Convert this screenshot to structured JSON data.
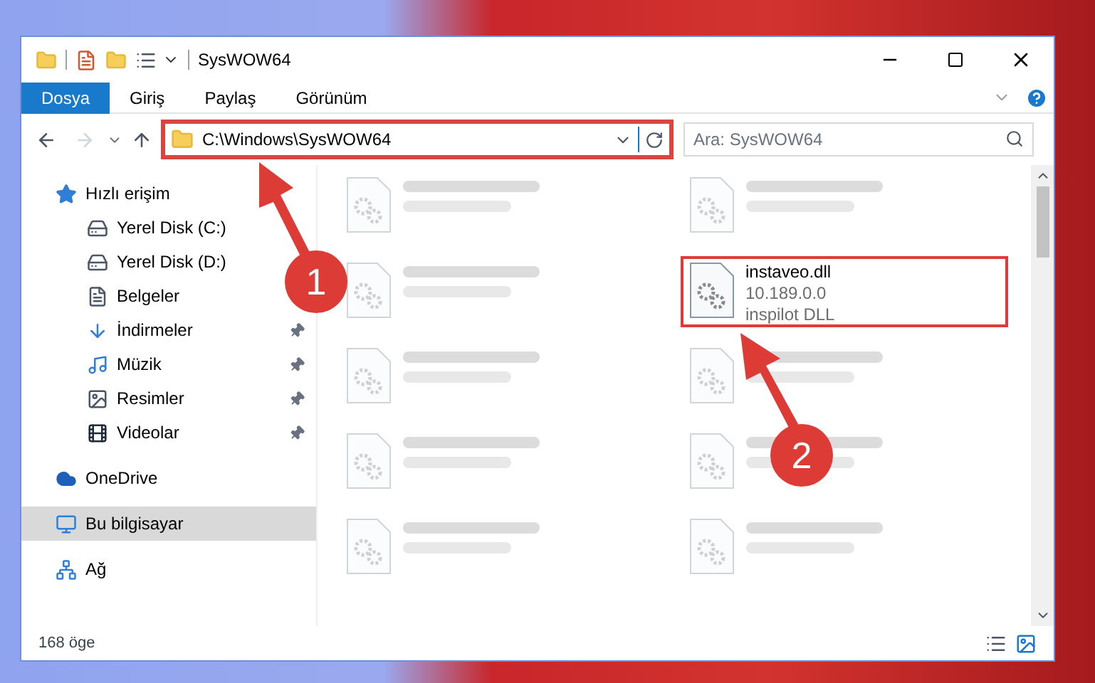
{
  "window": {
    "title": "SysWOW64"
  },
  "ribbon_tabs": [
    {
      "label": "Dosya",
      "selected": true
    },
    {
      "label": "Giriş",
      "selected": false
    },
    {
      "label": "Paylaş",
      "selected": false
    },
    {
      "label": "Görünüm",
      "selected": false
    }
  ],
  "address": {
    "path": "C:\\Windows\\SysWOW64",
    "highlighted": true
  },
  "search": {
    "placeholder": "Ara: SysWOW64"
  },
  "sidebar": {
    "items": [
      {
        "label": "Hızlı erişim",
        "kind": "star",
        "selected": false,
        "children": [
          {
            "label": "Yerel Disk (C:)",
            "kind": "drive",
            "pinned": false
          },
          {
            "label": "Yerel Disk (D:)",
            "kind": "drive",
            "pinned": false
          },
          {
            "label": "Belgeler",
            "kind": "document",
            "pinned": false
          },
          {
            "label": "İndirmeler",
            "kind": "download",
            "pinned": true
          },
          {
            "label": "Müzik",
            "kind": "music",
            "pinned": true
          },
          {
            "label": "Resimler",
            "kind": "pictures",
            "pinned": true
          },
          {
            "label": "Videolar",
            "kind": "video",
            "pinned": true
          }
        ]
      },
      {
        "label": "OneDrive",
        "kind": "cloud",
        "selected": false
      },
      {
        "label": "Bu bilgisayar",
        "kind": "computer",
        "selected": true
      },
      {
        "label": "Ağ",
        "kind": "network",
        "selected": false
      }
    ]
  },
  "files": [
    {
      "kind": "blurred"
    },
    {
      "kind": "blurred"
    },
    {
      "kind": "blurred"
    },
    {
      "kind": "file",
      "name": "instaveo.dll",
      "details": [
        "10.189.0.0",
        "inspilot DLL"
      ],
      "highlighted": true
    },
    {
      "kind": "blurred"
    },
    {
      "kind": "blurred"
    },
    {
      "kind": "blurred"
    },
    {
      "kind": "blurred"
    },
    {
      "kind": "blurred"
    },
    {
      "kind": "blurred"
    }
  ],
  "status_bar": {
    "count": "168 öge"
  },
  "annotations": [
    {
      "number": "1"
    },
    {
      "number": "2"
    }
  ]
}
